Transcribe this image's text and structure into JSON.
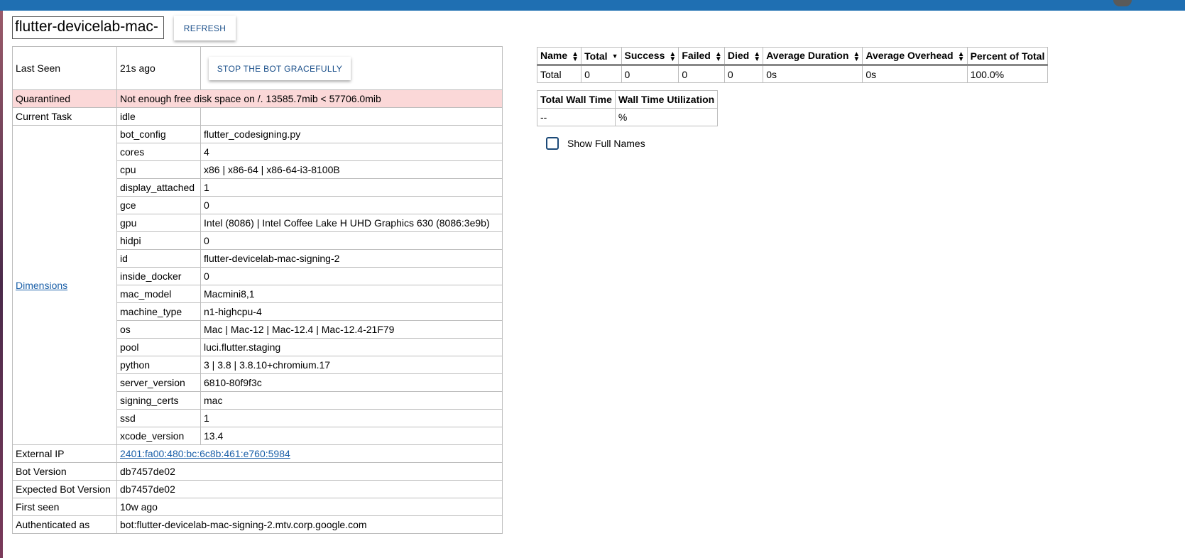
{
  "header": {
    "search_value": "flutter-devicelab-mac-",
    "refresh_label": "REFRESH",
    "avatar_icon": "user-avatar-icon"
  },
  "bot": {
    "last_seen_label": "Last Seen",
    "last_seen_value": "21s ago",
    "stop_label": "STOP THE BOT GRACEFULLY",
    "quarantined_label": "Quarantined",
    "quarantined_value": "Not enough free disk space on /. 13585.7mib < 57706.0mib",
    "current_task_label": "Current Task",
    "current_task_value": "idle",
    "dimensions_label": "Dimensions",
    "dimensions": [
      {
        "key": "bot_config",
        "value": "flutter_codesigning.py"
      },
      {
        "key": "cores",
        "value": "4"
      },
      {
        "key": "cpu",
        "value": "x86 | x86-64 | x86-64-i3-8100B"
      },
      {
        "key": "display_attached",
        "value": "1"
      },
      {
        "key": "gce",
        "value": "0"
      },
      {
        "key": "gpu",
        "value": "Intel (8086) | Intel Coffee Lake H UHD Graphics 630 (8086:3e9b)"
      },
      {
        "key": "hidpi",
        "value": "0"
      },
      {
        "key": "id",
        "value": "flutter-devicelab-mac-signing-2"
      },
      {
        "key": "inside_docker",
        "value": "0"
      },
      {
        "key": "mac_model",
        "value": "Macmini8,1"
      },
      {
        "key": "machine_type",
        "value": "n1-highcpu-4"
      },
      {
        "key": "os",
        "value": "Mac | Mac-12 | Mac-12.4 | Mac-12.4-21F79"
      },
      {
        "key": "pool",
        "value": "luci.flutter.staging"
      },
      {
        "key": "python",
        "value": "3 | 3.8 | 3.8.10+chromium.17"
      },
      {
        "key": "server_version",
        "value": "6810-80f9f3c"
      },
      {
        "key": "signing_certs",
        "value": "mac"
      },
      {
        "key": "ssd",
        "value": "1"
      },
      {
        "key": "xcode_version",
        "value": "13.4"
      }
    ],
    "external_ip_label": "External IP",
    "external_ip_value": "2401:fa00:480:bc:6c8b:461:e760:5984",
    "bot_version_label": "Bot Version",
    "bot_version_value": "db7457de02",
    "expected_bot_version_label": "Expected Bot Version",
    "expected_bot_version_value": "db7457de02",
    "first_seen_label": "First seen",
    "first_seen_value": "10w ago",
    "authenticated_label": "Authenticated as",
    "authenticated_value": "bot:flutter-devicelab-mac-signing-2.mtv.corp.google.com"
  },
  "stats": {
    "headers": [
      "Name",
      "Total",
      "Success",
      "Failed",
      "Died",
      "Average Duration",
      "Average Overhead",
      "Percent of Total"
    ],
    "row": [
      "Total",
      "0",
      "0",
      "0",
      "0",
      "0s",
      "0s",
      "100.0%"
    ]
  },
  "wall": {
    "headers": [
      "Total Wall Time",
      "Wall Time Utilization"
    ],
    "row": [
      "--",
      "%"
    ]
  },
  "show_full_names_label": "Show Full Names"
}
